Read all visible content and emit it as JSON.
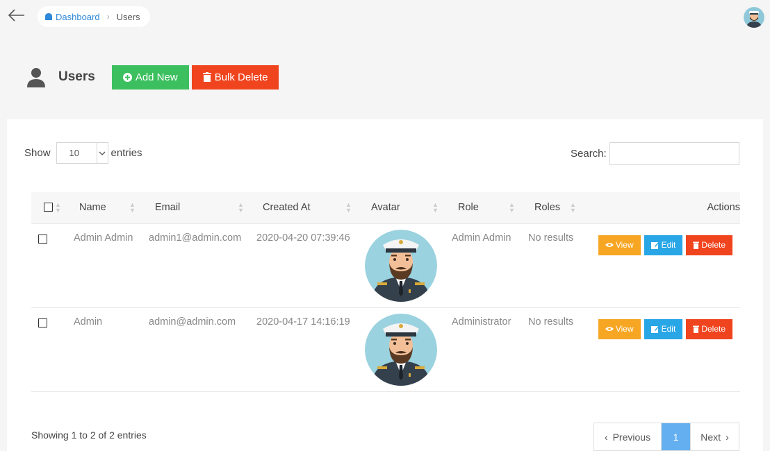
{
  "breadcrumb": {
    "home": "Dashboard",
    "current": "Users"
  },
  "header": {
    "title": "Users",
    "add_label": "Add New",
    "bulk_label": "Bulk Delete"
  },
  "controls": {
    "show_label": "Show",
    "entries_label": "entries",
    "page_length": "10",
    "search_label": "Search:",
    "search_value": ""
  },
  "table": {
    "columns": [
      "Name",
      "Email",
      "Created At",
      "Avatar",
      "Role",
      "Roles",
      "Actions"
    ],
    "rows": [
      {
        "name": "Admin Admin",
        "email": "admin1@admin.com",
        "created_at": "2020-04-20 07:39:46",
        "role": "Admin Admin",
        "roles": "No results"
      },
      {
        "name": "Admin",
        "email": "admin@admin.com",
        "created_at": "2020-04-17 14:16:19",
        "role": "Administrator",
        "roles": "No results"
      }
    ],
    "actions": {
      "view": "View",
      "edit": "Edit",
      "delete": "Delete"
    }
  },
  "footer": {
    "info": "Showing 1 to 2 of 2 entries",
    "prev": "Previous",
    "page": "1",
    "next": "Next"
  },
  "colors": {
    "add": "#3cc05f",
    "bulk": "#f0441e",
    "view": "#f7a623",
    "edit": "#29a6e6",
    "delete": "#f0441e",
    "page_active": "#64aff0",
    "link": "#2f88d8"
  },
  "icons": {
    "back": "arrow-left-icon",
    "home": "home-icon",
    "user": "user-icon",
    "add": "plus-circle-icon",
    "trash": "trash-icon",
    "eye": "eye-icon",
    "edit": "edit-icon",
    "avatar": "captain-avatar"
  }
}
